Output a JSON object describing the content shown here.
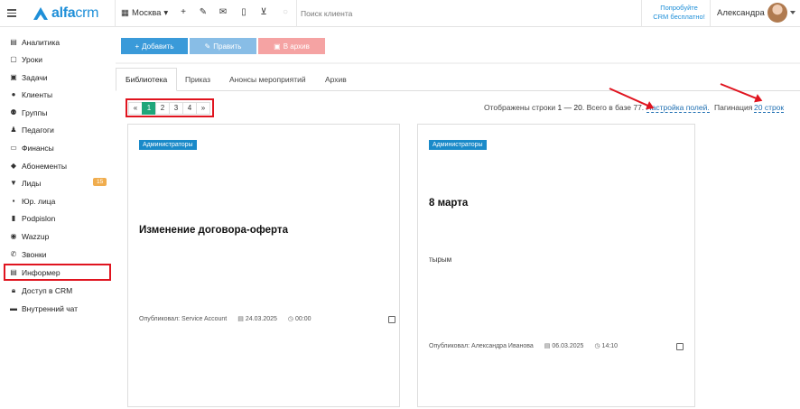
{
  "brand": {
    "logo_main": "alfa",
    "logo_suffix": "crm"
  },
  "topbar": {
    "city": "Москва",
    "search_placeholder": "Поиск клиента",
    "promo_line1": "Попробуйте",
    "promo_line2": "CRM бесплатно!",
    "user_name": "Александра"
  },
  "sidebar": {
    "items": [
      {
        "label": "Аналитика",
        "icon": "chart-icon"
      },
      {
        "label": "Уроки",
        "icon": "calendar-icon"
      },
      {
        "label": "Задачи",
        "icon": "tasks-icon"
      },
      {
        "label": "Клиенты",
        "icon": "user-icon"
      },
      {
        "label": "Группы",
        "icon": "group-icon"
      },
      {
        "label": "Педагоги",
        "icon": "teacher-icon"
      },
      {
        "label": "Финансы",
        "icon": "money-icon"
      },
      {
        "label": "Абонементы",
        "icon": "tag-icon"
      },
      {
        "label": "Лиды",
        "icon": "funnel-icon",
        "badge": "15"
      },
      {
        "label": "Юр. лица",
        "icon": "briefcase-icon"
      },
      {
        "label": "Podpislon",
        "icon": "document-icon"
      },
      {
        "label": "Wazzup",
        "icon": "chat-icon"
      },
      {
        "label": "Звонки",
        "icon": "phone-icon"
      },
      {
        "label": "Информер",
        "icon": "list-icon",
        "active": true
      },
      {
        "label": "Доступ в CRM",
        "icon": "lock-icon"
      },
      {
        "label": "Внутренний чат",
        "icon": "comments-icon"
      }
    ]
  },
  "toolbar": {
    "add_label": "Добавить",
    "edit_label": "Править",
    "archive_label": "В архив"
  },
  "tabs": [
    {
      "label": "Библиотека",
      "active": true
    },
    {
      "label": "Приказ"
    },
    {
      "label": "Анонсы мероприятий"
    },
    {
      "label": "Архив"
    }
  ],
  "pagination": {
    "prev": "«",
    "pages": [
      "1",
      "2",
      "3",
      "4"
    ],
    "next": "»",
    "current": "1"
  },
  "summary": {
    "prefix": "Отображены строки",
    "range": "1 — 20",
    "total_text": ". Всего в базе 77.",
    "settings_link": "Настройка полей.",
    "pagination_label": "Пагинация",
    "rows_link": "20 строк"
  },
  "cards": [
    {
      "tag": "Администраторы",
      "title": "Изменение договора-оферта",
      "body": "",
      "author": "Опубликовал: Service Account",
      "date": "24.03.2025",
      "time": "00:00"
    },
    {
      "tag": "Администраторы",
      "title": "8 марта",
      "body": "тырым",
      "author": "Опубликовал: Александра Иванова",
      "date": "06.03.2025",
      "time": "14:10"
    }
  ],
  "colors": {
    "brand_blue": "#1f8fd8",
    "add_button": "#3a9ad9",
    "edit_button": "#88bde6",
    "archive_button": "#f5a3a3",
    "active_page": "#1fa67a",
    "tag": "#1a8ac9",
    "highlight_red": "#e0141f",
    "badge_orange": "#f0ad4e"
  }
}
